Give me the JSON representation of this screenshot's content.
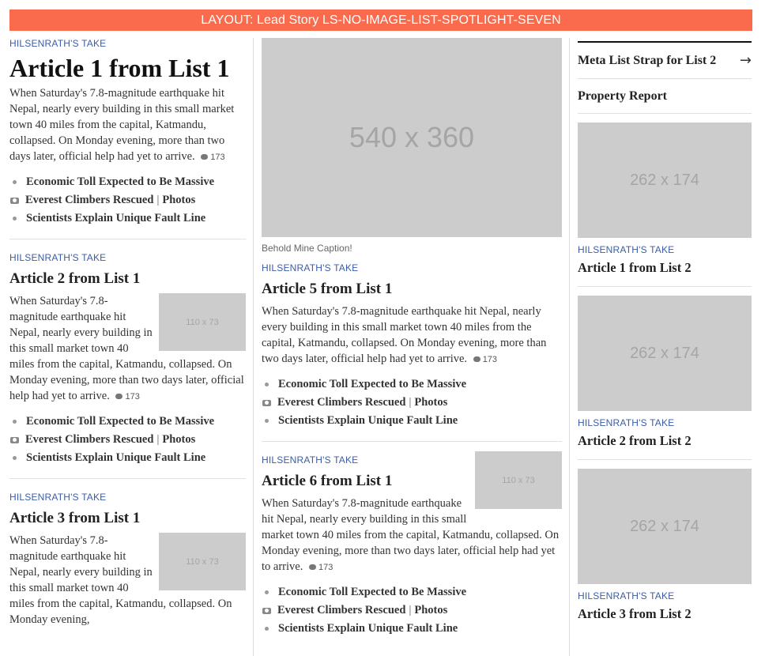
{
  "banner": "LAYOUT: Lead Story LS-NO-IMAGE-LIST-SPOTLIGHT-SEVEN",
  "flag": "HILSENRATH'S TAKE",
  "summary_text": "When Saturday's 7.8-magnitude earthquake hit Nepal, nearly every building in this small market town 40 miles from the capital, Katmandu, collapsed. On Monday evening, more than two days later, official help had yet to arrive.",
  "comment_count": "173",
  "bullets": {
    "b1": "Economic Toll Expected to Be Massive",
    "b2": "Everest Climbers Rescued",
    "b2_pipe": "|",
    "b2_photos": "Photos",
    "b3": "Scientists Explain Unique Fault Line"
  },
  "left": {
    "a1_title": "Article 1 from List 1",
    "a2_title": "Article 2 from List 1",
    "a3_title": "Article 3 from List 1",
    "thumb_label": "110 x 73",
    "a3_partial": "When Saturday's 7.8-magnitude earthquake hit Nepal, nearly every building in this small market town 40 miles from the capital, Katmandu, collapsed. On Monday evening,"
  },
  "middle": {
    "hero_label": "540 x 360",
    "caption": "Behold Mine Caption!",
    "a5_title": "Article 5 from List 1",
    "a6_title": "Article 6 from List 1",
    "thumb_label": "110 x 73"
  },
  "right": {
    "strap": "Meta List Strap for List 2",
    "strap_arrow": "→",
    "property": "Property Report",
    "image_label": "262 x 174",
    "a1_title": "Article 1 from List 2",
    "a2_title": "Article 2 from List 2",
    "a3_title": "Article 3 from List 2"
  },
  "colors": {
    "banner": "#fa6a4c",
    "flag": "#3b5da7",
    "placeholder": "#cccccc"
  }
}
